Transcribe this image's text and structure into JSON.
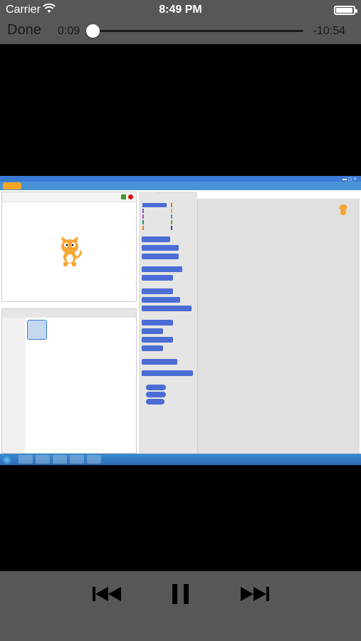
{
  "status_bar": {
    "carrier": "Carrier",
    "time": "8:49 PM",
    "wifi_icon": "wifi-icon",
    "battery_icon": "battery-icon",
    "battery_level": 0.95
  },
  "player": {
    "done_label": "Done",
    "elapsed": "0:09",
    "remaining": "-10:54",
    "progress": 0.014,
    "controls": {
      "previous_icon": "skip-back-icon",
      "pause_icon": "pause-icon",
      "next_icon": "skip-forward-icon"
    }
  },
  "colors": {
    "chrome_bg": "#555759",
    "video_bg": "#000000",
    "track_remaining": "#1a1a1a",
    "track_played": "#ffffff",
    "scratch_blue": "#4a92d6",
    "motion_block": "#4a6cd4"
  }
}
